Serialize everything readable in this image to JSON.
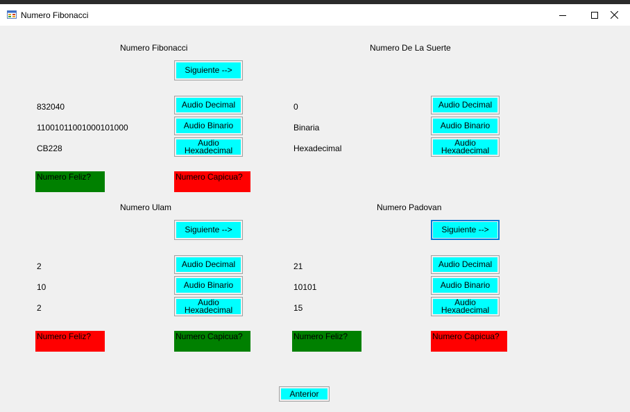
{
  "window": {
    "title": "Numero Fibonacci",
    "icon": "windows-forms-app-icon",
    "controls": [
      "minimize-icon",
      "maximize-icon",
      "close-icon"
    ]
  },
  "fibonacci": {
    "heading": "Numero Fibonacci",
    "next_label": "Siguiente -->",
    "decimal_value": "832040",
    "binary_value": "11001011001000101000",
    "hex_value": "CB228",
    "audio_decimal": "Audio Decimal",
    "audio_binary": "Audio Binario",
    "audio_hex": "Audio Hexadecimal",
    "happy_label": "Numero Feliz?",
    "happy_color": "#008000",
    "palindrome_label": "Numero Capicua?",
    "palindrome_color": "#ff0000"
  },
  "lucky": {
    "heading": "Numero De La Suerte",
    "decimal_value": "0",
    "binary_value": "Binaria",
    "hex_value": "Hexadecimal",
    "audio_decimal": "Audio Decimal",
    "audio_binary": "Audio Binario",
    "audio_hex": "Audio Hexadecimal"
  },
  "ulam": {
    "heading": "Numero Ulam",
    "next_label": "Siguiente -->",
    "decimal_value": "2",
    "binary_value": "10",
    "hex_value": "2",
    "audio_decimal": "Audio Decimal",
    "audio_binary": "Audio Binario",
    "audio_hex": "Audio Hexadecimal",
    "happy_label": "Numero Feliz?",
    "happy_color": "#ff0000",
    "palindrome_label": "Numero Capicua?",
    "palindrome_color": "#008000"
  },
  "padovan": {
    "heading": "Numero Padovan",
    "next_label": "Siguiente -->",
    "decimal_value": "21",
    "binary_value": "10101",
    "hex_value": "15",
    "audio_decimal": "Audio Decimal",
    "audio_binary": "Audio Binario",
    "audio_hex": "Audio Hexadecimal",
    "happy_label": "Numero Feliz?",
    "happy_color": "#008000",
    "palindrome_label": "Numero Capicua?",
    "palindrome_color": "#ff0000"
  },
  "footer": {
    "back_label": "Anterior"
  },
  "colors": {
    "button_face": "#00ffff",
    "form_background": "#f0f0f0",
    "focus_border": "#0078d7"
  }
}
